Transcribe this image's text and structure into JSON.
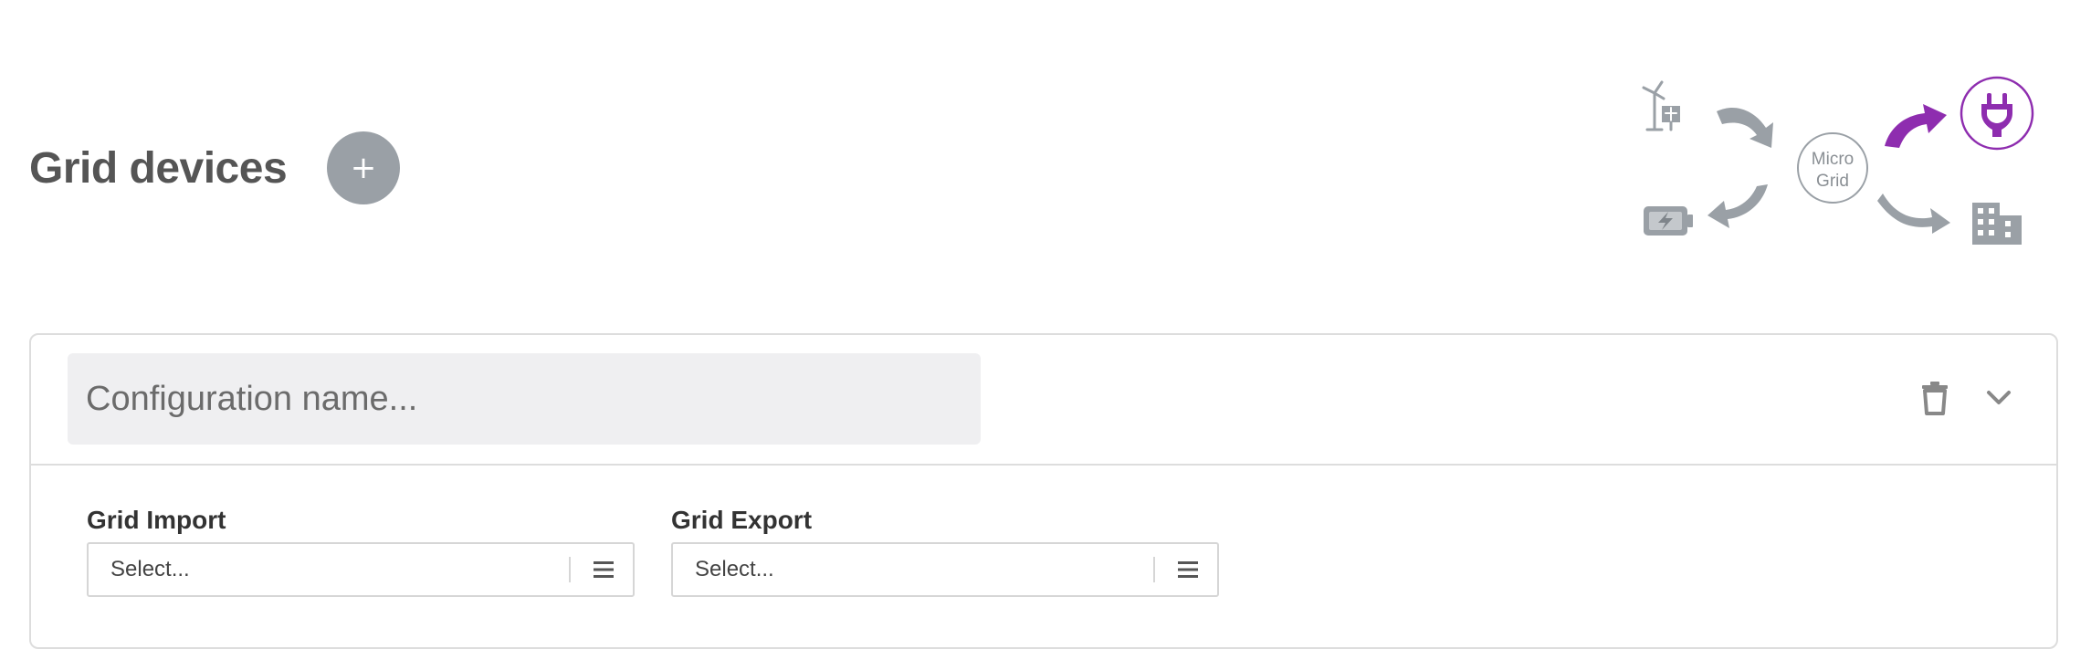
{
  "header": {
    "title": "Grid devices",
    "add_button_label": "+"
  },
  "flow_diagram": {
    "center_label_line1": "Micro",
    "center_label_line2": "Grid",
    "accent_color": "#8e2daf",
    "inactive_color": "#9aa0a6",
    "icons": [
      "renewables-icon",
      "battery-icon",
      "grid-plug-icon",
      "building-icon"
    ],
    "highlighted": "grid-plug-icon"
  },
  "config": {
    "name_placeholder": "Configuration name...",
    "name_value": "",
    "fields": [
      {
        "label": "Grid Import",
        "value": "Select..."
      },
      {
        "label": "Grid Export",
        "value": "Select..."
      }
    ]
  }
}
